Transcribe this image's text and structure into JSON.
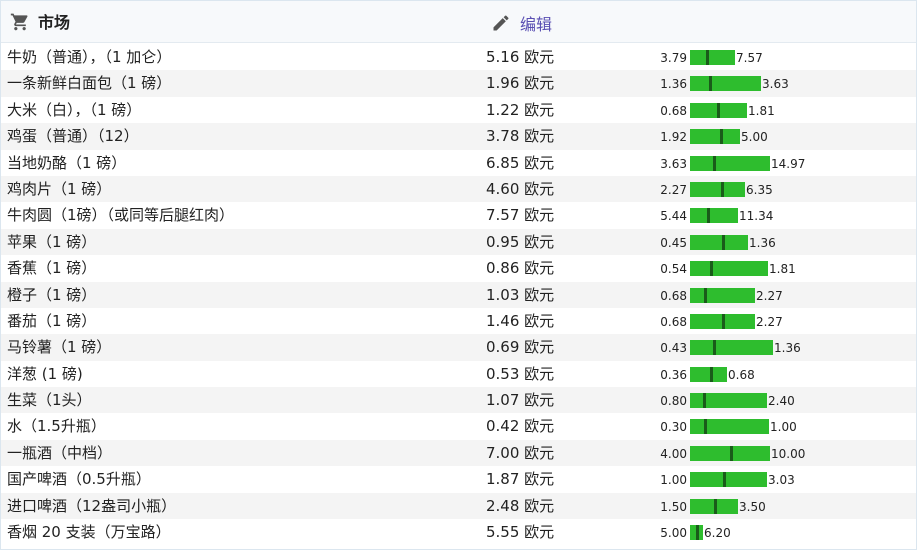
{
  "header": {
    "title": "市场",
    "edit_label": "编辑",
    "cart_icon": "cart-icon",
    "edit_icon": "pencil-icon"
  },
  "colors": {
    "bar": "#2ebd2e",
    "marker": "#1a5c1a",
    "edit": "#5a4fb3"
  },
  "rows": [
    {
      "name": "牛奶（普通），（1 加仑）",
      "price": "5.16 欧元",
      "low": "3.79",
      "high": "7.57"
    },
    {
      "name": "一条新鲜白面包（1 磅）",
      "price": "1.96 欧元",
      "low": "1.36",
      "high": "3.63"
    },
    {
      "name": "大米（白），（1 磅）",
      "price": "1.22 欧元",
      "low": "0.68",
      "high": "1.81"
    },
    {
      "name": "鸡蛋（普通）（12）",
      "price": "3.78 欧元",
      "low": "1.92",
      "high": "5.00"
    },
    {
      "name": "当地奶酪（1 磅）",
      "price": "6.85 欧元",
      "low": "3.63",
      "high": "14.97"
    },
    {
      "name": "鸡肉片（1 磅）",
      "price": "4.60 欧元",
      "low": "2.27",
      "high": "6.35"
    },
    {
      "name": "牛肉圆（1磅）（或同等后腿红肉）",
      "price": "7.57 欧元",
      "low": "5.44",
      "high": "11.34"
    },
    {
      "name": "苹果（1 磅）",
      "price": "0.95 欧元",
      "low": "0.45",
      "high": "1.36"
    },
    {
      "name": "香蕉（1 磅）",
      "price": "0.86 欧元",
      "low": "0.54",
      "high": "1.81"
    },
    {
      "name": "橙子（1 磅）",
      "price": "1.03 欧元",
      "low": "0.68",
      "high": "2.27"
    },
    {
      "name": "番茄（1 磅）",
      "price": "1.46 欧元",
      "low": "0.68",
      "high": "2.27"
    },
    {
      "name": "马铃薯（1 磅）",
      "price": "0.69 欧元",
      "low": "0.43",
      "high": "1.36"
    },
    {
      "name": "洋葱 (1 磅)",
      "price": "0.53 欧元",
      "low": "0.36",
      "high": "0.68"
    },
    {
      "name": "生菜（1头）",
      "price": "1.07 欧元",
      "low": "0.80",
      "high": "2.40"
    },
    {
      "name": "水（1.5升瓶）",
      "price": "0.42 欧元",
      "low": "0.30",
      "high": "1.00"
    },
    {
      "name": "一瓶酒（中档）",
      "price": "7.00 欧元",
      "low": "4.00",
      "high": "10.00"
    },
    {
      "name": "国产啤酒（0.5升瓶）",
      "price": "1.87 欧元",
      "low": "1.00",
      "high": "3.03"
    },
    {
      "name": "进口啤酒（12盎司小瓶）",
      "price": "2.48 欧元",
      "low": "1.50",
      "high": "3.50"
    },
    {
      "name": "香烟 20 支装（万宝路）",
      "price": "5.55 欧元",
      "low": "5.00",
      "high": "6.20"
    }
  ]
}
